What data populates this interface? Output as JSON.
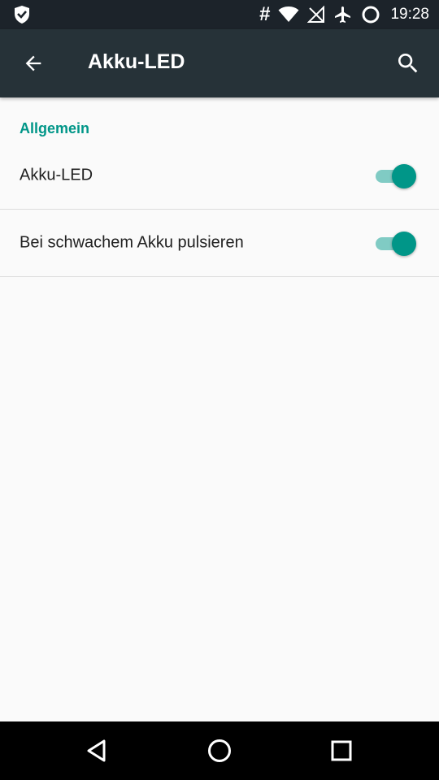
{
  "status_bar": {
    "icons": [
      "shield-icon",
      "hash-icon",
      "wifi-icon",
      "no-signal-icon",
      "airplane-icon",
      "sync-icon"
    ],
    "hash_glyph": "#",
    "time": "19:28"
  },
  "app_bar": {
    "title": "Akku-LED",
    "back_icon": "arrow-back-icon",
    "search_icon": "search-icon"
  },
  "section": {
    "header": "Allgemein"
  },
  "preferences": [
    {
      "label": "Akku-LED",
      "enabled": true
    },
    {
      "label": "Bei schwachem Akku pulsieren",
      "enabled": true
    }
  ],
  "nav_bar": {
    "buttons": [
      "back-triangle-icon",
      "home-circle-icon",
      "recents-square-icon"
    ]
  },
  "colors": {
    "status_bar": "#1c232a",
    "app_bar": "#263238",
    "accent": "#009688",
    "switch_track": "#80cbc4",
    "background": "#fafafa"
  }
}
